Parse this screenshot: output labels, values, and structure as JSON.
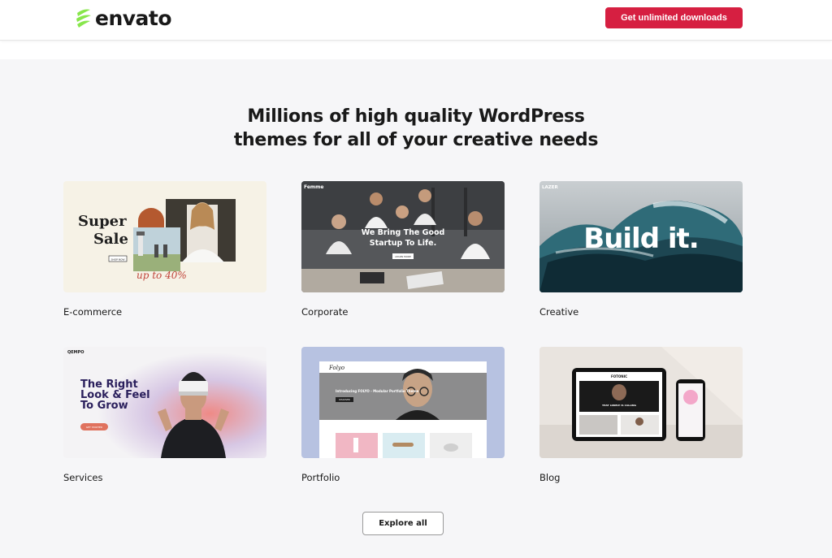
{
  "header": {
    "logo_text": "envato",
    "cta_label": "Get unlimited downloads",
    "brand_green": "#87e64b",
    "cta_color": "#d61f41"
  },
  "hero": {
    "headline_line1": "Millions of high quality WordPress",
    "headline_line2": "themes for all of your creative needs"
  },
  "categories": [
    {
      "label": "E-commerce",
      "preview": {
        "line1": "Super",
        "line2": "Sale",
        "button": "SHOP NOW",
        "promo": "up to 40%"
      }
    },
    {
      "label": "Corporate",
      "preview": {
        "brand": "Femme",
        "line1": "We Bring The Good",
        "line2": "Startup To Life.",
        "button": "LEARN MORE"
      }
    },
    {
      "label": "Creative",
      "preview": {
        "brand": "LAZER",
        "headline": "Build it."
      }
    },
    {
      "label": "Services",
      "preview": {
        "brand": "QEMPO",
        "line1": "The Right",
        "line2": "Look & Feel",
        "line3": "To Grow",
        "button": "GET STARTED"
      }
    },
    {
      "label": "Portfolio",
      "preview": {
        "brand": "Folyo",
        "headline": "Introducing FOLYO - Modular Portfolio Theme",
        "button": "DISCOVER"
      }
    },
    {
      "label": "Blog",
      "preview": {
        "brand": "FOTONIC",
        "headline": "THAT LONELY IS CALLING"
      }
    }
  ],
  "explore_label": "Explore all"
}
